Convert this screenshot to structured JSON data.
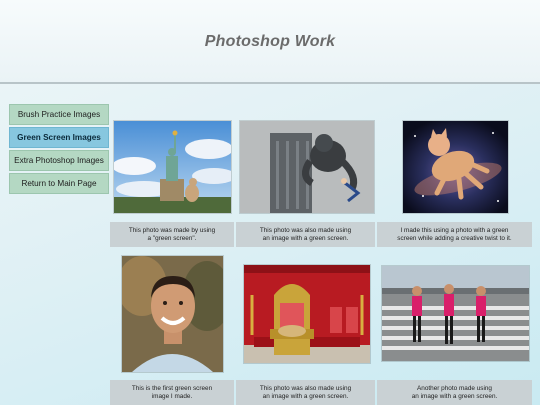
{
  "page": {
    "title": "Photoshop Work"
  },
  "nav": {
    "items": [
      {
        "label": "Brush Practice Images"
      },
      {
        "label": "Green Screen Images"
      },
      {
        "label": "Extra Photoshop Images"
      },
      {
        "label": "Return to Main Page"
      }
    ]
  },
  "photos": {
    "row1": [
      {
        "caption_l1": "This photo was made by using",
        "caption_l2": "a \"green screen\"."
      },
      {
        "caption_l1": "This photo was also made using",
        "caption_l2": "an image with a green screen."
      },
      {
        "caption_l1": "I made this using a photo with a green",
        "caption_l2": "screen while adding a creative twist to it."
      }
    ],
    "row2": [
      {
        "caption_l1": "This is the first green screen",
        "caption_l2": "image I made."
      },
      {
        "caption_l1": "This photo was also made using",
        "caption_l2": "an image with a green screen."
      },
      {
        "caption_l1": "Another photo made using",
        "caption_l2": "an image with a green screen."
      }
    ]
  },
  "colors": {
    "nav_bg": "#b4d8c3",
    "nav_active": "#87c7df",
    "caption_bg": "#c9d1d4"
  }
}
